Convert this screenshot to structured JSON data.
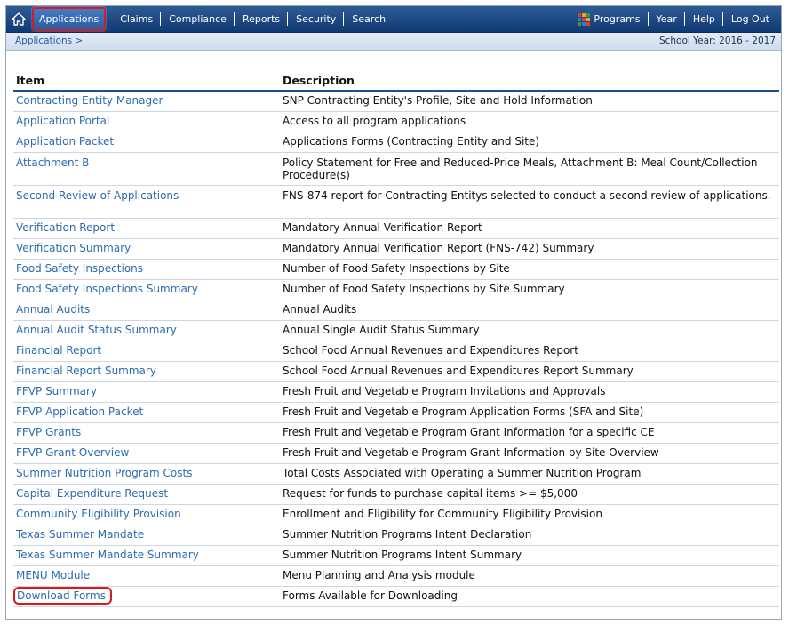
{
  "nav": {
    "items": [
      {
        "label": "Applications",
        "name": "nav-applications",
        "active": true
      },
      {
        "label": "Claims",
        "name": "nav-claims"
      },
      {
        "label": "Compliance",
        "name": "nav-compliance"
      },
      {
        "label": "Reports",
        "name": "nav-reports"
      },
      {
        "label": "Security",
        "name": "nav-security"
      },
      {
        "label": "Search",
        "name": "nav-search"
      }
    ],
    "right_items": [
      {
        "label": "Programs",
        "name": "nav-programs",
        "icon": "programs-grid-icon"
      },
      {
        "label": "Year",
        "name": "nav-year"
      },
      {
        "label": "Help",
        "name": "nav-help"
      },
      {
        "label": "Log Out",
        "name": "nav-log-out"
      }
    ],
    "home_icon": "home-icon",
    "active_color": "#d81b1b"
  },
  "breadcrumb": {
    "text": "Applications >"
  },
  "school_year": "School Year: 2016 - 2017",
  "table": {
    "headers": {
      "item": "Item",
      "description": "Description"
    },
    "rows": [
      {
        "item": "Contracting Entity Manager",
        "description": "SNP Contracting Entity's Profile, Site and Hold Information"
      },
      {
        "item": "Application Portal",
        "description": "Access to all program applications"
      },
      {
        "item": "Application Packet",
        "description": "Applications Forms (Contracting Entity and Site)"
      },
      {
        "item": "Attachment B",
        "description": "Policy Statement for Free and Reduced-Price Meals, Attachment B: Meal Count/Collection Procedure(s)",
        "wrap": true
      },
      {
        "item": "Second Review of Applications",
        "description": "FNS-874 report for Contracting Entitys selected to conduct a second review of applications.",
        "wrap": true
      },
      {
        "item": "Verification Report",
        "description": "Mandatory Annual Verification Report"
      },
      {
        "item": "Verification Summary",
        "description": "Mandatory Annual Verification Report (FNS-742) Summary"
      },
      {
        "item": "Food Safety Inspections",
        "description": "Number of Food Safety Inspections by Site"
      },
      {
        "item": "Food Safety Inspections Summary",
        "description": "Number of Food Safety Inspections by Site Summary"
      },
      {
        "item": "Annual Audits",
        "description": "Annual Audits"
      },
      {
        "item": "Annual Audit Status Summary",
        "description": "Annual Single Audit Status Summary"
      },
      {
        "item": "Financial Report",
        "description": "School Food Annual Revenues and Expenditures Report"
      },
      {
        "item": "Financial Report Summary",
        "description": "School Food Annual Revenues and Expenditures Report Summary"
      },
      {
        "item": "FFVP Summary",
        "description": "Fresh Fruit and Vegetable Program Invitations and Approvals"
      },
      {
        "item": "FFVP Application Packet",
        "description": "Fresh Fruit and Vegetable Program Application Forms (SFA and Site)"
      },
      {
        "item": "FFVP Grants",
        "description": "Fresh Fruit and Vegetable Program Grant Information for a specific CE"
      },
      {
        "item": "FFVP Grant Overview",
        "description": "Fresh Fruit and Vegetable Program Grant Information by Site Overview"
      },
      {
        "item": "Summer Nutrition Program Costs",
        "description": "Total Costs Associated with Operating a Summer Nutrition Program"
      },
      {
        "item": "Capital Expenditure Request",
        "description": "Request for funds to purchase capital items >= $5,000"
      },
      {
        "item": "Community Eligibility Provision",
        "description": "Enrollment and Eligibility for Community Eligibility Provision"
      },
      {
        "item": "Texas Summer Mandate",
        "description": "Summer Nutrition Programs Intent Declaration"
      },
      {
        "item": "Texas Summer Mandate Summary",
        "description": "Summer Nutrition Programs Intent Summary"
      },
      {
        "item": "MENU Module",
        "description": "Menu Planning and Analysis module"
      },
      {
        "item": "Download Forms",
        "description": "Forms Available for Downloading",
        "highlight": true
      }
    ]
  }
}
